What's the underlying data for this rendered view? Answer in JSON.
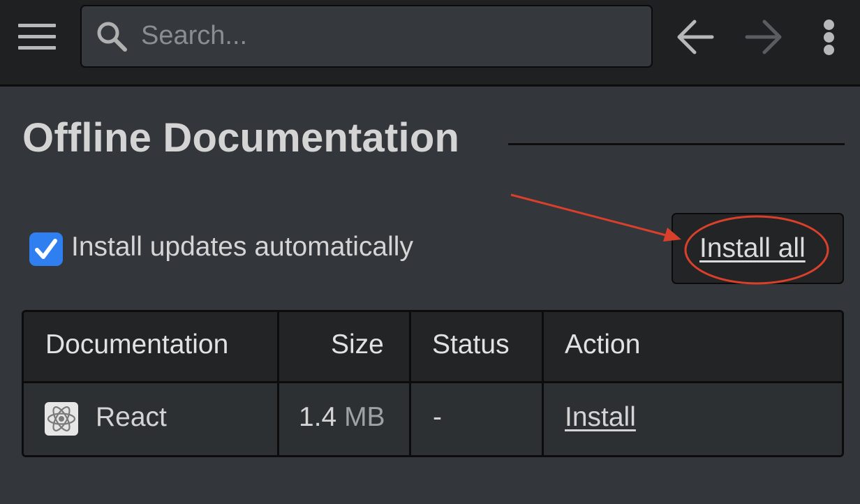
{
  "header": {
    "search_placeholder": "Search...",
    "icons": {
      "menu": "hamburger-menu-icon",
      "search": "search-icon",
      "back": "arrow-left-icon",
      "forward": "arrow-right-icon",
      "more": "kebab-menu-icon"
    }
  },
  "page": {
    "title": "Offline Documentation"
  },
  "settings": {
    "auto_update_label": "Install updates automatically",
    "auto_update_checked": true,
    "install_all_label": "Install all"
  },
  "table": {
    "columns": [
      "Documentation",
      "Size",
      "Status",
      "Action"
    ],
    "rows": [
      {
        "name": "React",
        "icon": "react-logo-icon",
        "size_value": "1.4",
        "size_unit": "MB",
        "status": "-",
        "action": "Install"
      }
    ]
  },
  "colors": {
    "accent": "#2f7ff0",
    "annotation": "#d9402b"
  }
}
